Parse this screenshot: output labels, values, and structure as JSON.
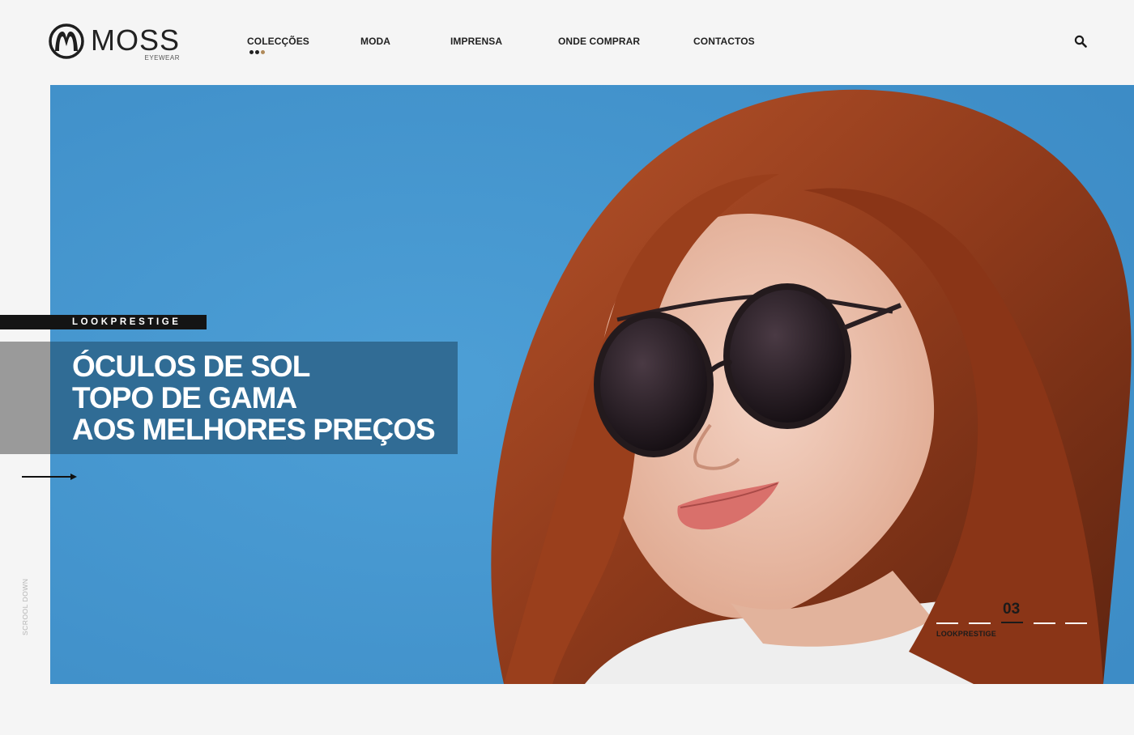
{
  "brand": {
    "name": "MOSS",
    "sub": "EYEWEAR",
    "logo_icon": "moss-m-circle-logo"
  },
  "nav": {
    "items": [
      {
        "label": "COLECÇÕES"
      },
      {
        "label": "MODA"
      },
      {
        "label": "IMPRENSA"
      },
      {
        "label": "ONDE COMPRAR"
      },
      {
        "label": "CONTACTOS"
      }
    ],
    "active_dots_colors": [
      "#222222",
      "#222222",
      "#b08a5a"
    ],
    "search_icon": "search-icon"
  },
  "hero": {
    "tag": "LOOKPRESTIGE",
    "headline": [
      "ÓCULOS DE SOL",
      "TOPO DE GAMA",
      "AOS MELHORES PREÇOS"
    ],
    "next_arrow_icon": "arrow-right-icon",
    "scroll_label": "SCROOL DOWN",
    "background_color": "#4697cf"
  },
  "slider": {
    "current": "03",
    "label": "LOOKPRESTIGE",
    "total_dashes": 5,
    "active_index": 2
  }
}
